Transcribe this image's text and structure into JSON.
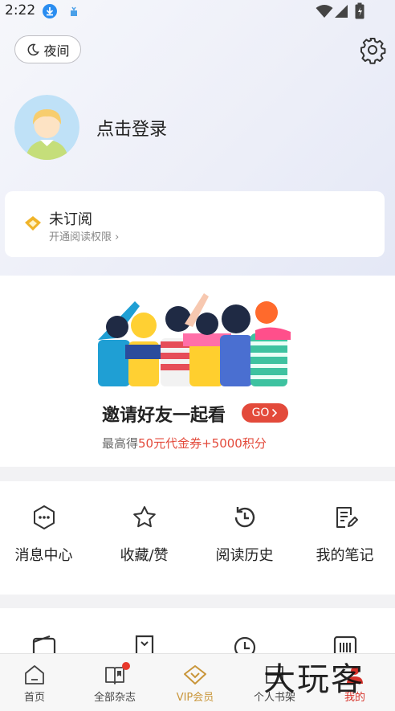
{
  "status_bar": {
    "time": "2:22"
  },
  "header": {
    "night_label": "夜间"
  },
  "profile": {
    "login_label": "点击登录"
  },
  "subscription": {
    "title": "未订阅",
    "subtitle": "开通阅读权限"
  },
  "invite": {
    "title": "邀请好友一起看",
    "go_label": "GO",
    "sub_prefix": "最高得",
    "sub_highlight": "50元代金券+5000积分"
  },
  "quick_actions": [
    {
      "label": "消息中心",
      "icon": "message-icon"
    },
    {
      "label": "收藏/赞",
      "icon": "star-icon"
    },
    {
      "label": "阅读历史",
      "icon": "history-icon"
    },
    {
      "label": "我的笔记",
      "icon": "note-icon"
    }
  ],
  "bottom_nav": [
    {
      "label": "首页",
      "icon": "home-icon"
    },
    {
      "label": "全部杂志",
      "icon": "magazine-icon"
    },
    {
      "label": "VIP会员",
      "icon": "vip-icon"
    },
    {
      "label": "个人书架",
      "icon": "bookshelf-icon"
    },
    {
      "label": "我的",
      "icon": "me-icon"
    }
  ],
  "watermark": "大玩客",
  "colors": {
    "accent_red": "#e34a3b",
    "vip_gold": "#c9963a",
    "active_red": "#d6322a"
  }
}
